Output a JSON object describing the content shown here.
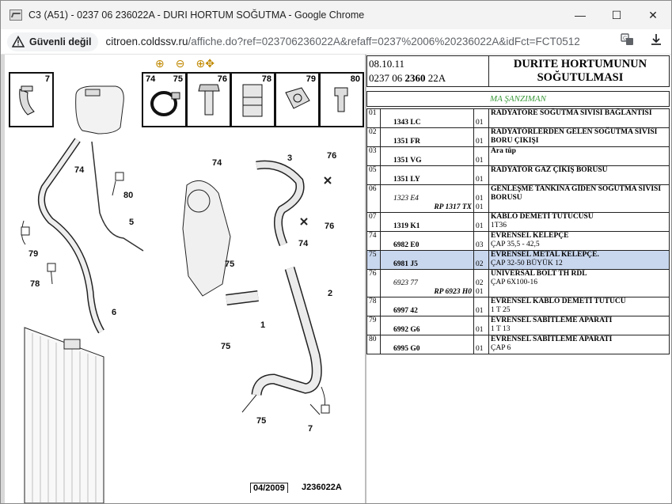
{
  "browser": {
    "tab_title": "C3 (A51) - 0237 06 236022A - DURI HORTUM SOĞUTMA - Google Chrome",
    "security_label": "Güvenli değil",
    "url_host": "citroen.coldssv.ru",
    "url_path": "/affiche.do?ref=023706236022A&refaff=0237%2006%20236022A&idFct=FCT0512",
    "minimize": "—",
    "maximize": "☐",
    "close": "✕"
  },
  "diagram": {
    "zoom_in": "⊕",
    "zoom_out": "⊖",
    "zoom_pan": "⊕✥",
    "thumbs": [
      {
        "num": "7"
      },
      {
        "num_a": "74",
        "num_b": "75"
      },
      {
        "num": "76"
      },
      {
        "num": "78"
      },
      {
        "num": "79"
      },
      {
        "num": "80"
      }
    ],
    "callouts": [
      "74",
      "80",
      "5",
      "79",
      "78",
      "6",
      "3",
      "76",
      "74",
      "76",
      "74",
      "75",
      "1",
      "2",
      "75",
      "75",
      "7"
    ],
    "footer_date": "04/2009",
    "footer_code": "J236022A"
  },
  "parts": {
    "date": "08.10.11",
    "ref_pre": "0237 06 ",
    "ref_bold": "2360",
    "ref_post": " 22A",
    "title": "DURITE HORTUMUNUN SOĞUTULMASI",
    "subtitle": "MA ŞANZIMAN",
    "rows": [
      {
        "no": "01",
        "code": "1343 LC",
        "qty": "01",
        "desc": "RADYATÖRE SOĞUTMA SIVISI BAĞLANTISI",
        "extra": ""
      },
      {
        "no": "02",
        "code": "1351 FR",
        "qty": "01",
        "desc": "RADYATÖRLERDEN GELEN SOĞUTMA SIVISI BORU ÇIKIŞI",
        "extra": ""
      },
      {
        "no": "03",
        "code": "1351 VG",
        "qty": "01",
        "desc": "Ara tüp",
        "extra": ""
      },
      {
        "no": "05",
        "code": "1351 LY",
        "qty": "01",
        "desc": "RADYATÖR GAZ ÇIKIŞ BORUSU",
        "extra": ""
      },
      {
        "no": "06",
        "code": "1323 E4",
        "rp": "RP 1317 TX",
        "qty": "01",
        "qty2": "01",
        "desc": "GENLEŞME TANKINA GİDEN SOĞUTMA SIVISI BORUSU",
        "extra": ""
      },
      {
        "no": "07",
        "code": "1319 K1",
        "qty": "01",
        "desc": "KABLO DEMETİ TUTUCUSU",
        "extra": "1T36"
      },
      {
        "no": "74",
        "code": "6982 E0",
        "qty": "03",
        "desc": "EVRENSEL KELEPÇE",
        "extra": "ÇAP 35,5 - 42,5"
      },
      {
        "no": "75",
        "code": "6981 J5",
        "qty": "02",
        "desc": "EVRENSEL METAL KELEPÇE.",
        "extra": "ÇAP 32-50 BÜYÜK 12",
        "selected": true
      },
      {
        "no": "76",
        "code": "6923 77",
        "rp": "RP 6923 H0",
        "qty": "02",
        "qty2": "01",
        "desc": "UNIVERSAL BOLT TH RDL",
        "extra": "ÇAP 6X100-16"
      },
      {
        "no": "78",
        "code": "6997 42",
        "qty": "01",
        "desc": "EVRENSEL KABLO DEMETİ TUTUCU",
        "extra": "1 T 25"
      },
      {
        "no": "79",
        "code": "6992 G6",
        "qty": "01",
        "desc": "EVRENSEL SABİTLEME APARATI",
        "extra": "1 T 13"
      },
      {
        "no": "80",
        "code": "6995 G0",
        "qty": "01",
        "desc": "EVRENSEL SABİTLEME APARATI",
        "extra": "ÇAP 6"
      }
    ]
  }
}
